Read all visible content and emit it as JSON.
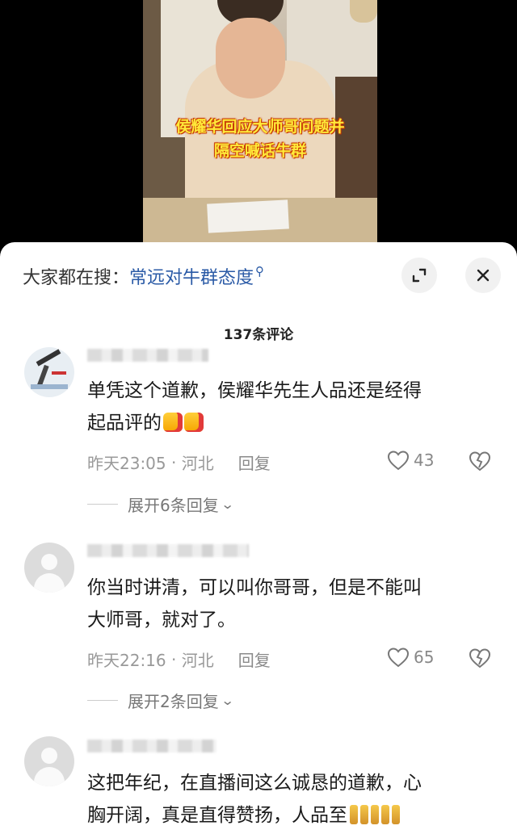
{
  "video": {
    "caption_line1": "侯耀华回应大师哥问题并",
    "caption_line2": "隔空喊话牛群"
  },
  "search": {
    "prefix": "大家都在搜：",
    "term": "常远对牛群态度"
  },
  "comments_header": {
    "count_label": "137条评论"
  },
  "comments": [
    {
      "text_line1": "单凭这个道歉，侯耀华先生人品还是经得",
      "text_line2": "起品评的",
      "time": "昨天23:05",
      "location": "河北",
      "reply_label": "回复",
      "likes": "43",
      "expand_label": "展开6条回复"
    },
    {
      "text_line1": "你当时讲清，可以叫你哥哥，但是不能叫",
      "text_line2": "大师哥，就对了。",
      "time": "昨天22:16",
      "location": "河北",
      "reply_label": "回复",
      "likes": "65",
      "expand_label": "展开2条回复"
    },
    {
      "text_line1": "这把年纪，在直播间这么诚恳的道歉，心",
      "text_line2": "胸开阔，真是直得赞扬，人品至"
    }
  ],
  "colors": {
    "accent_link": "#2a5aa6",
    "caption_fill": "#ffea3a",
    "caption_outline": "#c83a00",
    "meta_gray": "#999999"
  },
  "icons": {
    "search_suffix": "search-icon",
    "expand": "expand-icon",
    "close": "close-icon",
    "like": "heart-icon",
    "dislike": "broken-heart-icon"
  }
}
